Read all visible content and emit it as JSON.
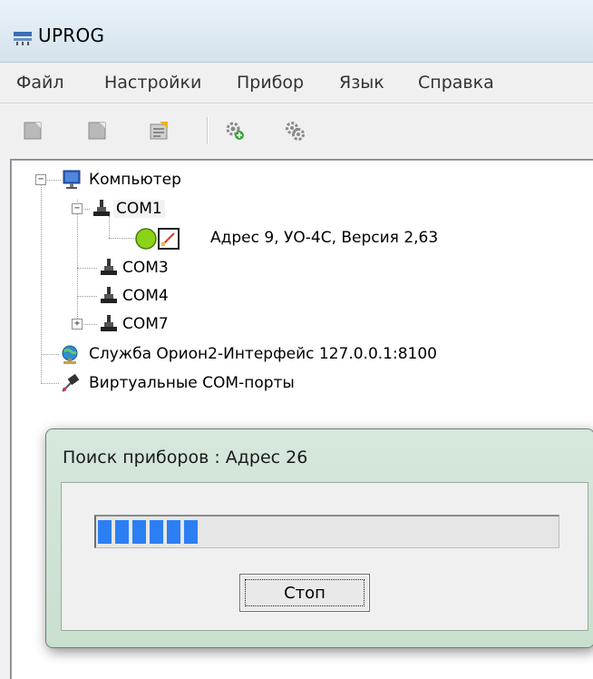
{
  "window": {
    "title": "UPROG"
  },
  "menu": [
    "Файл",
    "Настройки",
    "Прибор",
    "Язык",
    "Справка"
  ],
  "toolbar": {
    "buttons": [
      "new-icon",
      "open-icon",
      "properties-icon",
      "add-settings-icon",
      "settings-icon"
    ]
  },
  "tree": {
    "computer": "Компьютер",
    "ports": [
      "COM1",
      "COM3",
      "COM4",
      "COM7"
    ],
    "device": "Адрес 9, УО-4С, Версия 2,63",
    "service": "Служба Орион2-Интерфейс 127.0.0.1:8100",
    "virtual": "Виртуальные COM-порты",
    "expanders": {
      "expanded": "−",
      "collapsed": "+"
    }
  },
  "dialog": {
    "title": "Поиск приборов : Адрес 26",
    "progress_segments": 6,
    "stop_label": "Стоп"
  },
  "colors": {
    "progress": "#2c7ff3",
    "dialog_frame": "#c9dfce",
    "device_status": "#8bd317"
  }
}
